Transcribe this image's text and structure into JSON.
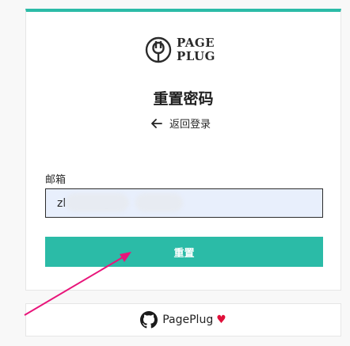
{
  "logo": {
    "line1": "PAGE",
    "line2": "PLUG"
  },
  "page_title": "重置密码",
  "back_link": {
    "label": "返回登录",
    "icon": "arrow-left-icon"
  },
  "form": {
    "email_label": "邮箱",
    "email_value": "zl          @          .cn",
    "submit_label": "重置"
  },
  "footer": {
    "link_text": "PagePlug",
    "icons": [
      "github-icon",
      "heart-icon"
    ]
  },
  "colors": {
    "accent": "#2bbba7",
    "input_bg": "#e8effc",
    "annotation_arrow": "#e8157a",
    "heart": "#e0103a"
  }
}
